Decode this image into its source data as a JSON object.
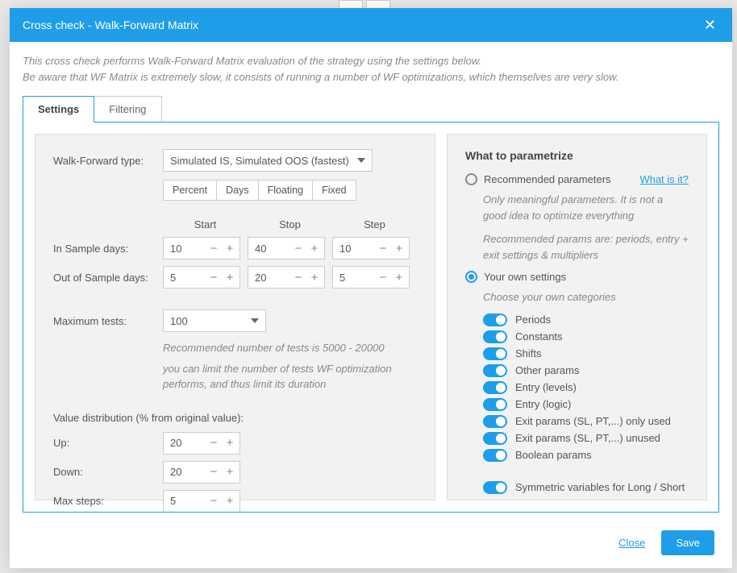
{
  "title": "Cross check - Walk-Forward Matrix",
  "description": {
    "line1": "This cross check performs Walk-Forward Matrix evaluation of the strategy using the settings below.",
    "line2": "Be aware that WF Matrix is extremely slow, it consists of running a number of WF optimizations, which themselves are very slow."
  },
  "tabs": {
    "settings": "Settings",
    "filtering": "Filtering"
  },
  "left": {
    "wf_type_label": "Walk-Forward type:",
    "wf_type_value": "Simulated IS, Simulated OOS (fastest)",
    "seg": {
      "percent": "Percent",
      "days": "Days",
      "floating": "Floating",
      "fixed": "Fixed"
    },
    "head": {
      "start": "Start",
      "stop": "Stop",
      "step": "Step"
    },
    "in_sample_label": "In Sample days:",
    "in_sample": {
      "start": "10",
      "stop": "40",
      "step": "10"
    },
    "out_sample_label": "Out of Sample days:",
    "out_sample": {
      "start": "5",
      "stop": "20",
      "step": "5"
    },
    "max_tests_label": "Maximum tests:",
    "max_tests_value": "100",
    "note1": "Recommended number of tests is 5000 - 20000",
    "note2": "you can limit the number of tests WF optimization performs, and thus limit its duration",
    "dist_label": "Value distribution (% from original value):",
    "up_label": "Up:",
    "up": "20",
    "down_label": "Down:",
    "down": "20",
    "max_steps_label": "Max steps:",
    "max_steps": "5"
  },
  "right": {
    "heading": "What to parametrize",
    "recommended": "Recommended parameters",
    "what_is_it": "What is it?",
    "rec_note1": "Only meaningful parameters. It is not a good idea to optimize everything",
    "rec_note2": "Recommended params are: periods, entry + exit settings & multipliers",
    "own": "Your own settings",
    "own_note": "Choose your own categories",
    "toggles": [
      "Periods",
      "Constants",
      "Shifts",
      "Other params",
      "Entry (levels)",
      "Entry (logic)",
      "Exit params (SL, PT,...) only used",
      "Exit params (SL, PT,...) unused",
      "Boolean params"
    ],
    "symmetric": "Symmetric variables for Long / Short"
  },
  "footer": {
    "close": "Close",
    "save": "Save"
  }
}
